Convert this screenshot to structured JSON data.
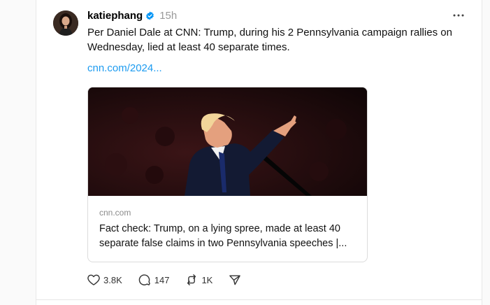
{
  "post": {
    "username": "katiephang",
    "timestamp": "15h",
    "text": "Per Daniel Dale at CNN: Trump, during his 2 Pennsylvania campaign rallies on Wednesday, lied at least 40 separate times.",
    "link_text": "cnn.com/2024...",
    "link_card": {
      "domain": "cnn.com",
      "title": "Fact check: Trump, on a lying spree, made at least 40 separate false claims in two Pennsylvania speeches |..."
    },
    "actions": {
      "likes": "3.8K",
      "replies": "147",
      "reposts": "1K"
    }
  },
  "icons": {
    "verified": "verified-badge-icon",
    "more": "more-options-icon",
    "like": "heart-icon",
    "reply": "comment-icon",
    "repost": "repost-icon",
    "share": "send-icon"
  },
  "colors": {
    "link": "#1d9bf0",
    "verified": "#0095f6",
    "muted": "#999999"
  }
}
